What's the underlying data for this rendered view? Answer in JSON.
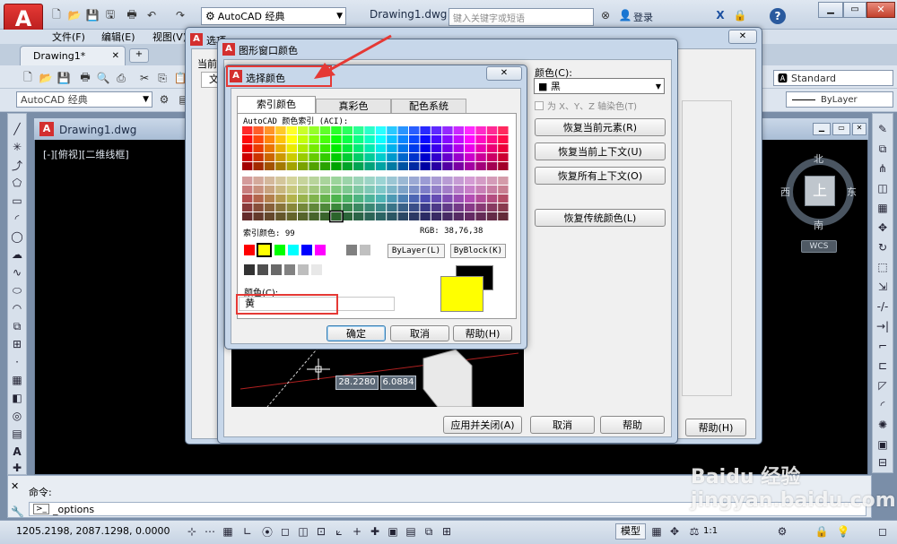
{
  "app": {
    "workspace_combo": "AutoCAD 经典",
    "file_title": "Drawing1.dwg",
    "search_placeholder": "键入关键字或短语",
    "login_label": "登录",
    "help_label": "?"
  },
  "menu": [
    "文件(F)",
    "编辑(E)",
    "视图(V)"
  ],
  "doc_tab": "Drawing1*",
  "toolbar_combo2": "AutoCAD 经典",
  "style_combo": "Standard",
  "bylayer_combo": "ByLayer",
  "drawing_window": {
    "title": "Drawing1.dwg",
    "viewport_label": "[-][俯视][二维线框]",
    "coord_x": "28.2280",
    "coord_y": "6.0884"
  },
  "viewcube": {
    "north": "北",
    "south": "南",
    "east": "东",
    "west": "西",
    "top": "上",
    "wcs": "WCS"
  },
  "options_dialog": {
    "title": "选项",
    "partial": "当前",
    "partial_tab": "文",
    "help_button": "帮助(H)"
  },
  "graphics_color_dialog": {
    "title": "图形窗口颜色",
    "color_label": "颜色(C):",
    "color_value": "■ 黑",
    "tint_checkbox": "为 X、Y、Z 轴染色(T)",
    "btn_restore_element": "恢复当前元素(R)",
    "btn_restore_context": "恢复当前上下文(U)",
    "btn_restore_all": "恢复所有上下文(O)",
    "btn_restore_classic": "恢复传统颜色(L)",
    "btn_apply_close": "应用并关闭(A)",
    "btn_cancel": "取消",
    "btn_help": "帮助"
  },
  "select_color_dialog": {
    "title": "选择颜色",
    "tabs": [
      "索引颜色",
      "真彩色",
      "配色系统"
    ],
    "aci_label": "AutoCAD 颜色索引 (ACI):",
    "index_label": "索引颜色: 99",
    "rgb_label": "RGB: 38,76,38",
    "bylayer_btn": "ByLayer(L)",
    "byblock_btn": "ByBlock(K)",
    "color_field_label": "颜色(C):",
    "color_field_value": "黄",
    "ok": "确定",
    "cancel": "取消",
    "help": "帮助(H)"
  },
  "command": {
    "label": "命令:",
    "input": "_options"
  },
  "status": {
    "coords": "1205.2198, 2087.1298, 0.0000",
    "model": "模型",
    "scale": "1:1"
  },
  "watermark": "Baidu 经验 jingyan.baidu.com",
  "colors": {
    "accent_red": "#d32f2f",
    "highlight_box": "#e53935",
    "current_color": "#ffff00"
  }
}
